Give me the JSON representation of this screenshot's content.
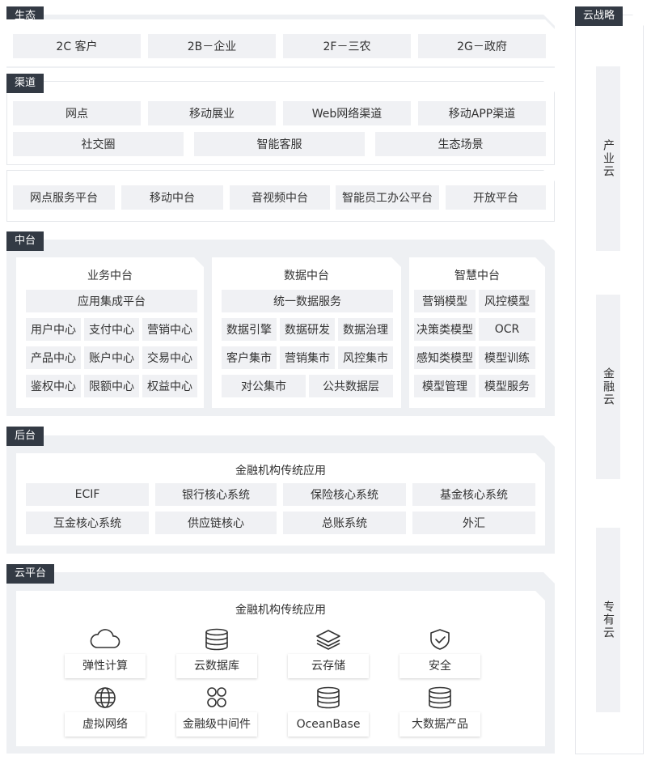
{
  "ecosystem": {
    "tag": "生态",
    "items": [
      "2C 客户",
      "2B－企业",
      "2F－三农",
      "2G－政府"
    ]
  },
  "channel": {
    "tag": "渠道",
    "row1": [
      "网点",
      "移动展业",
      "Web网络渠道",
      "移动APP渠道"
    ],
    "row2": [
      "社交圈",
      "智能客服",
      "生态场景"
    ]
  },
  "platforms": {
    "items": [
      "网点服务平台",
      "移动中台",
      "音视频中台",
      "智能员工办公平台",
      "开放平台"
    ]
  },
  "middle": {
    "tag": "中台",
    "business": {
      "title": "业务中台",
      "banner": "应用集成平台",
      "rows": [
        [
          "用户中心",
          "支付中心",
          "营销中心"
        ],
        [
          "产品中心",
          "账户中心",
          "交易中心"
        ],
        [
          "鉴权中心",
          "限额中心",
          "权益中心"
        ]
      ]
    },
    "data": {
      "title": "数据中台",
      "banner": "统一数据服务",
      "rows": [
        [
          "数据引擎",
          "数据研发",
          "数据治理"
        ],
        [
          "客户集市",
          "营销集市",
          "风控集市"
        ]
      ],
      "last": [
        "对公集市",
        "公共数据层"
      ]
    },
    "smart": {
      "title": "智慧中台",
      "rows": [
        [
          "营销模型",
          "风控模型"
        ],
        [
          "决策类模型",
          "OCR"
        ],
        [
          "感知类模型",
          "模型训练"
        ],
        [
          "模型管理",
          "模型服务"
        ]
      ]
    }
  },
  "backend": {
    "tag": "后台",
    "title": "金融机构传统应用",
    "row1": [
      "ECIF",
      "银行核心系统",
      "保险核心系统",
      "基金核心系统"
    ],
    "row2": [
      "互金核心系统",
      "供应链核心",
      "总账系统",
      "外汇"
    ]
  },
  "cloud_platform": {
    "tag": "云平台",
    "title": "金融机构传统应用",
    "items": [
      {
        "label": "弹性计算",
        "icon": "cloud-icon"
      },
      {
        "label": "云数据库",
        "icon": "database-icon"
      },
      {
        "label": "云存储",
        "icon": "layers-icon"
      },
      {
        "label": "安全",
        "icon": "shield-check-icon"
      },
      {
        "label": "虚拟网络",
        "icon": "globe-icon"
      },
      {
        "label": "金融级中间件",
        "icon": "grid-circles-icon"
      },
      {
        "label": "OceanBase",
        "icon": "database-icon"
      },
      {
        "label": "大数据产品",
        "icon": "database-icon"
      }
    ]
  },
  "strategy": {
    "tag": "云战略",
    "items": [
      "产业云",
      "金融云",
      "专有云"
    ]
  }
}
